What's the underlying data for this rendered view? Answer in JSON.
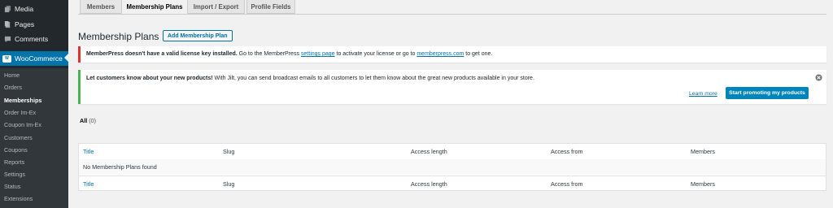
{
  "sidebar": {
    "top_items": [
      {
        "label": "Media",
        "icon": "media-icon"
      },
      {
        "label": "Pages",
        "icon": "pages-icon"
      },
      {
        "label": "Comments",
        "icon": "comments-icon"
      }
    ],
    "woocommerce_label": "WooCommerce",
    "woo_logo_text": "W",
    "submenu": [
      "Home",
      "Orders",
      "Memberships",
      "Order Im-Ex",
      "Coupon Im-Ex",
      "Customers",
      "Coupons",
      "Reports",
      "Settings",
      "Status",
      "Extensions"
    ],
    "active_submenu": "Memberships"
  },
  "tabs": [
    {
      "label": "Members",
      "active": false
    },
    {
      "label": "Membership Plans",
      "active": true
    },
    {
      "label": "Import / Export",
      "active": false
    },
    {
      "label": "Profile Fields",
      "active": false
    }
  ],
  "page": {
    "title": "Membership Plans",
    "add_button": "Add Membership Plan"
  },
  "license_notice": {
    "bold": "MemberPress doesn't have a valid license key installed.",
    "text1": " Go to the MemberPress ",
    "link1": "settings page",
    "text2": " to activate your license or go to ",
    "link2": "memberpress.com",
    "text3": " to get one.",
    "color": "#dc3232"
  },
  "jilt_notice": {
    "bold": "Let customers know about your new products!",
    "text": " With Jilt, you can send broadcast emails to all customers to let them know about the great new products available in your store.",
    "learn_more": "Learn more",
    "button": "Start promoting my products",
    "color": "#46b450"
  },
  "filter": {
    "label": "All",
    "count": "(0)"
  },
  "table": {
    "columns": [
      "Title",
      "Slug",
      "Access length",
      "Access from",
      "Members"
    ],
    "empty_message": "No Membership Plans found"
  },
  "colors": {
    "sidebar_bg": "#23282d",
    "submenu_bg": "#32373c",
    "accent": "#0073aa",
    "button_primary": "#0085ba"
  }
}
